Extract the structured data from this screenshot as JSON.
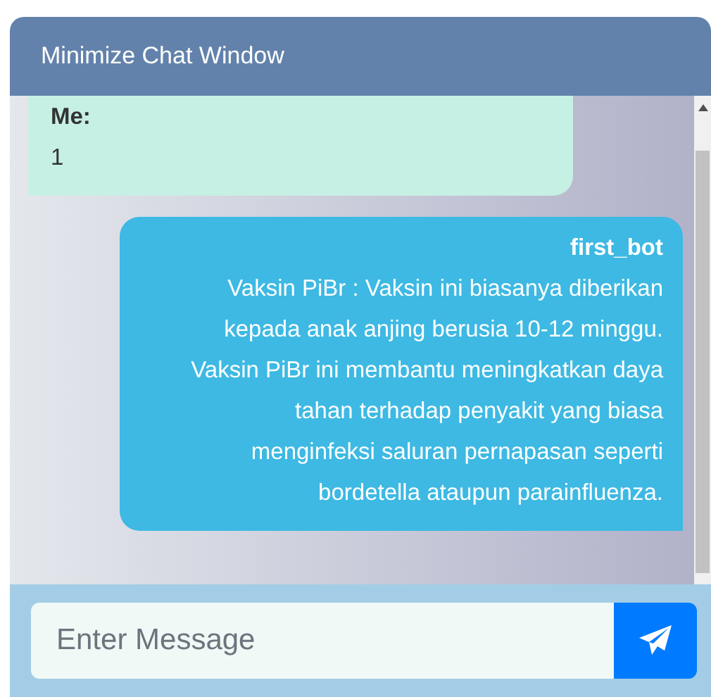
{
  "header": {
    "title": "Minimize Chat Window"
  },
  "messages": [
    {
      "kind": "user",
      "sender": "Me:",
      "text": "1"
    },
    {
      "kind": "bot",
      "sender": "first_bot",
      "text": "Vaksin PiBr : Vaksin ini biasanya diberikan kepada anak anjing berusia 10-12 minggu. Vaksin PiBr ini membantu meningkatkan daya tahan terhadap penyakit yang biasa menginfeksi saluran pernapasan seperti bordetella ataupun parainfluenza."
    }
  ],
  "composer": {
    "placeholder": "Enter Message"
  }
}
